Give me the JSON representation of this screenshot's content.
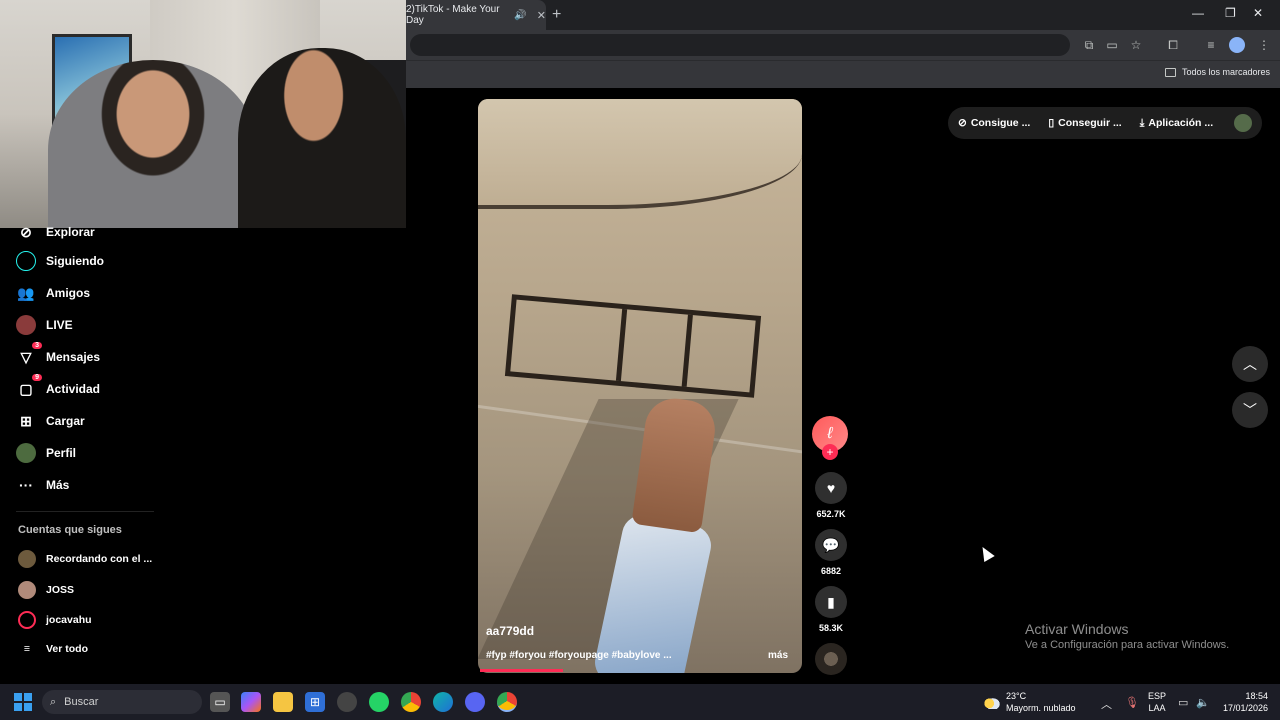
{
  "browser": {
    "tab_title": "2)TikTok - Make Your Day",
    "bookmarks_all": "Todos los marcadores"
  },
  "sidebar": {
    "items": [
      {
        "label": "Explorar",
        "icon": "compass-icon"
      },
      {
        "label": "Siguiendo",
        "icon": "following-icon"
      },
      {
        "label": "Amigos",
        "icon": "friends-icon"
      },
      {
        "label": "LIVE",
        "icon": "live-icon"
      },
      {
        "label": "Mensajes",
        "icon": "messages-icon",
        "badge": "3"
      },
      {
        "label": "Actividad",
        "icon": "activity-icon",
        "badge": "9"
      },
      {
        "label": "Cargar",
        "icon": "upload-icon"
      },
      {
        "label": "Perfil",
        "icon": "profile-icon"
      },
      {
        "label": "Más",
        "icon": "more-icon"
      }
    ],
    "following_title": "Cuentas que sigues",
    "following": [
      "Recordando con el ...",
      "JOSS",
      "jocavahu"
    ],
    "see_all": "Ver todo"
  },
  "video": {
    "username": "aa779dd",
    "caption": "#fyp #foryou #foryoupage #babylove ...",
    "more": "más",
    "progress": 0.26
  },
  "actions": {
    "likes": "652.7K",
    "comments": "6882",
    "saves": "58.3K"
  },
  "topbar": {
    "item1": "Consigue ...",
    "item2": "Conseguir ...",
    "item3": "Aplicación ..."
  },
  "watermark": {
    "title": "Activar Windows",
    "subtitle": "Ve a Configuración para activar Windows."
  },
  "taskbar": {
    "search_placeholder": "Buscar",
    "temperature": "23°C",
    "weather": "Mayorm. nublado",
    "lang1": "ESP",
    "lang2": "LAA",
    "time": "18:54",
    "date": "17/01/2026"
  }
}
